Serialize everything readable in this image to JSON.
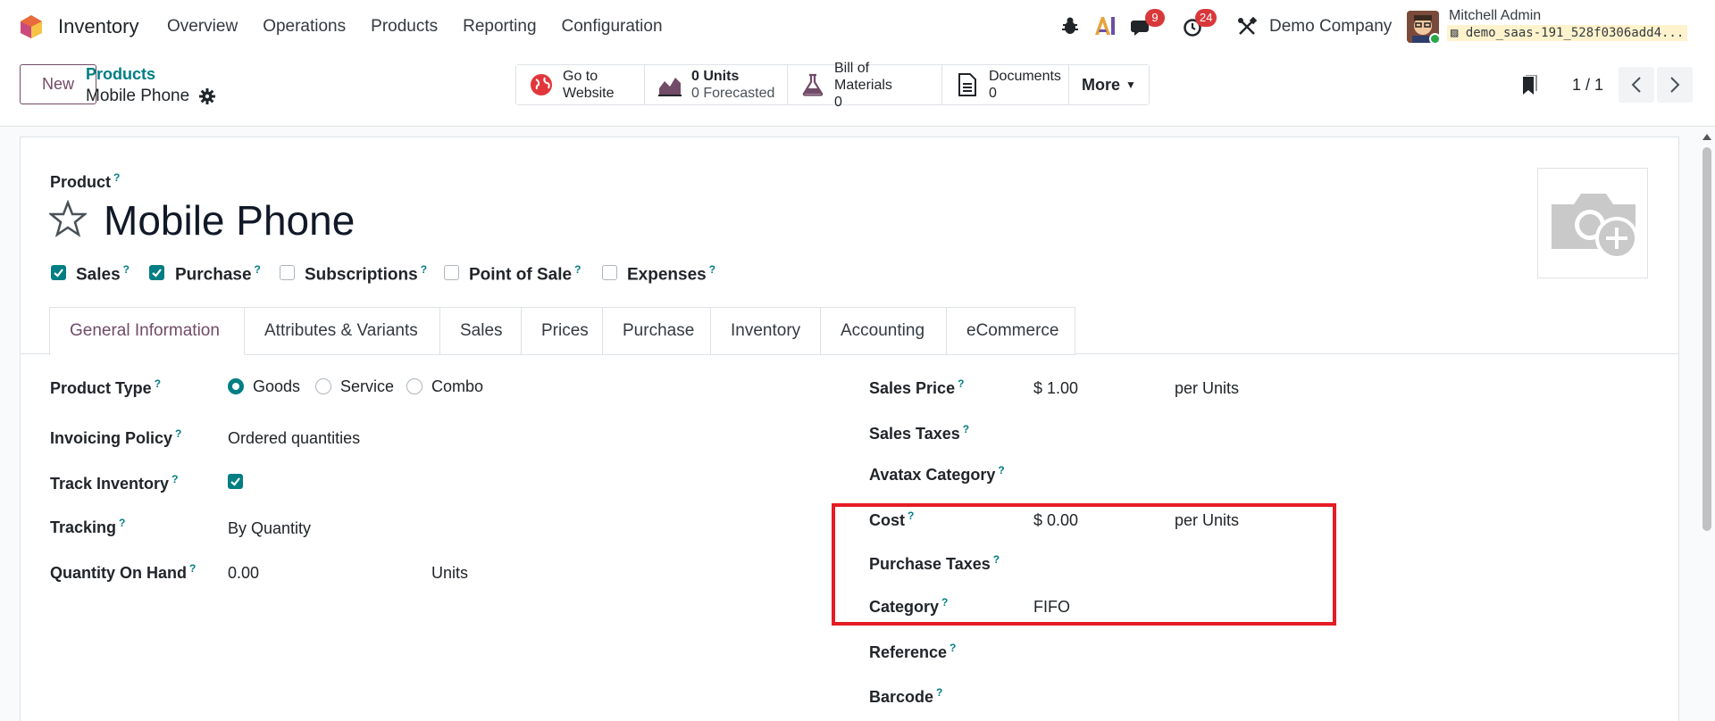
{
  "navbar": {
    "app_name": "Inventory",
    "menu": [
      "Overview",
      "Operations",
      "Products",
      "Reporting",
      "Configuration"
    ],
    "messages_badge": "9",
    "activities_badge": "24",
    "company": "Demo Company",
    "user_name": "Mitchell Admin",
    "database": "demo_saas-191_528f0306add4..."
  },
  "control": {
    "new_label": "New",
    "breadcrumb_parent": "Products",
    "breadcrumb_current": "Mobile Phone",
    "smart_buttons": {
      "website_line1": "Go to",
      "website_line2": "Website",
      "units_line1": "0 Units",
      "units_line2": "0 Forecasted",
      "bom_line1": "Bill of Materials",
      "bom_line2": "0",
      "docs_line1": "Documents",
      "docs_line2": "0",
      "more": "More"
    },
    "pager": "1 / 1"
  },
  "form": {
    "product_label": "Product",
    "product_name": "Mobile Phone",
    "checkboxes": [
      {
        "label": "Sales",
        "checked": true
      },
      {
        "label": "Purchase",
        "checked": true
      },
      {
        "label": "Subscriptions",
        "checked": false
      },
      {
        "label": "Point of Sale",
        "checked": false
      },
      {
        "label": "Expenses",
        "checked": false
      }
    ],
    "tabs": [
      "General Information",
      "Attributes & Variants",
      "Sales",
      "Prices",
      "Purchase",
      "Inventory",
      "Accounting",
      "eCommerce"
    ],
    "left": {
      "product_type_label": "Product Type",
      "product_type_options": [
        "Goods",
        "Service",
        "Combo"
      ],
      "invoicing_policy_label": "Invoicing Policy",
      "invoicing_policy_value": "Ordered quantities",
      "track_inventory_label": "Track Inventory",
      "tracking_label": "Tracking",
      "tracking_value": "By Quantity",
      "qty_on_hand_label": "Quantity On Hand",
      "qty_on_hand_value": "0.00",
      "qty_on_hand_unit": "Units"
    },
    "right": {
      "sales_price_label": "Sales Price",
      "sales_price_value": "$ 1.00",
      "sales_price_unit": "per Units",
      "sales_taxes_label": "Sales Taxes",
      "avatax_label": "Avatax Category",
      "cost_label": "Cost",
      "cost_value": "$ 0.00",
      "cost_unit": "per Units",
      "purchase_taxes_label": "Purchase Taxes",
      "category_label": "Category",
      "category_value": "FIFO",
      "reference_label": "Reference",
      "barcode_label": "Barcode"
    }
  },
  "colors": {
    "primary": "#714b67",
    "accent": "#017e84",
    "highlight": "#e51c23",
    "badge": "#d9383b"
  }
}
